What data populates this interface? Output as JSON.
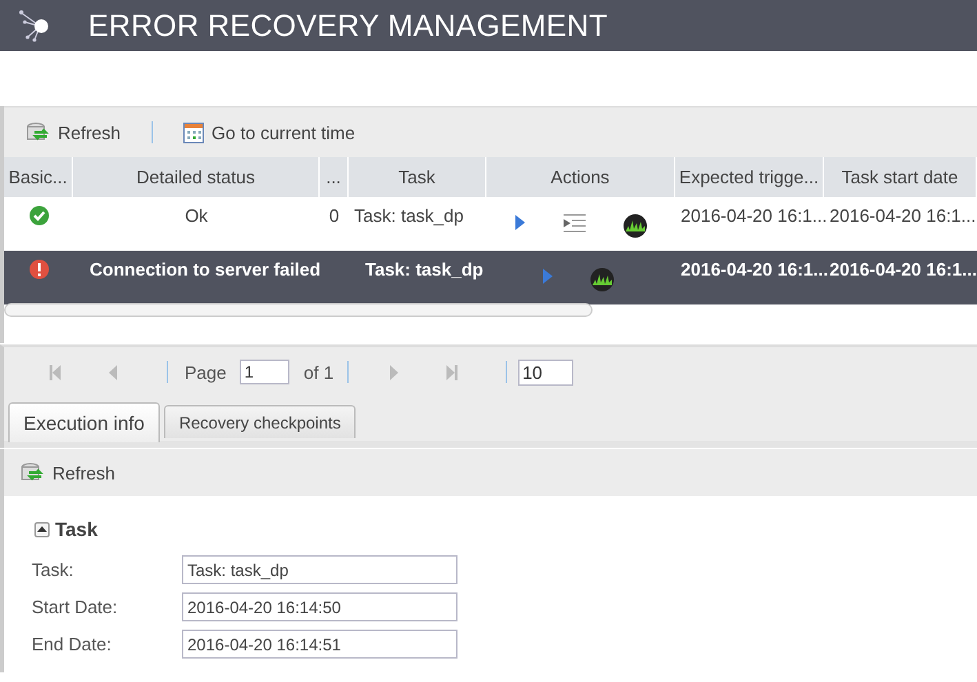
{
  "header": {
    "title": "ERROR RECOVERY MANAGEMENT"
  },
  "toolbar": [
    {
      "kind": "refresh",
      "label": "Refresh"
    },
    {
      "kind": "calendar",
      "label": "Go to current time"
    }
  ],
  "grid": {
    "columns": [
      "Basic...",
      "Detailed status",
      "...",
      "Task",
      "Actions",
      "Expected trigge...",
      "Task start date"
    ],
    "rows": [
      {
        "status": {
          "kind": "ok"
        },
        "detailed_status": "Ok",
        "count": "0",
        "task": "Task: task_dp",
        "actions": [
          {
            "kind": "run"
          },
          {
            "kind": "log"
          },
          {
            "kind": "monitor"
          }
        ],
        "expected_trigger": "2016-04-20 16:1...",
        "task_start": "2016-04-20 16:1...",
        "selected": false
      },
      {
        "status": {
          "kind": "error"
        },
        "detailed_status": "Connection to server failed",
        "task": "Task: task_dp",
        "actions": [
          {
            "kind": "run"
          },
          {
            "kind": "monitor"
          }
        ],
        "expected_trigger": "2016-04-20 16:1...",
        "task_start": "2016-04-20 16:1...",
        "selected": true
      }
    ]
  },
  "pager": {
    "page_label": "Page",
    "page": "1",
    "of": "of 1",
    "page_size": "10"
  },
  "tabs": [
    {
      "label": "Execution info",
      "selected": true
    },
    {
      "label": "Recovery checkpoints",
      "selected": false
    }
  ],
  "detail": {
    "toolbar": [
      {
        "kind": "refresh",
        "label": "Refresh"
      }
    ],
    "section": {
      "title": "Task",
      "expanded": true
    },
    "fields": [
      {
        "label": "Task:",
        "value": "Task: task_dp"
      },
      {
        "label": "Start Date:",
        "value": "2016-04-20 16:14:50"
      },
      {
        "label": "End Date:",
        "value": "2016-04-20 16:14:51"
      }
    ]
  }
}
